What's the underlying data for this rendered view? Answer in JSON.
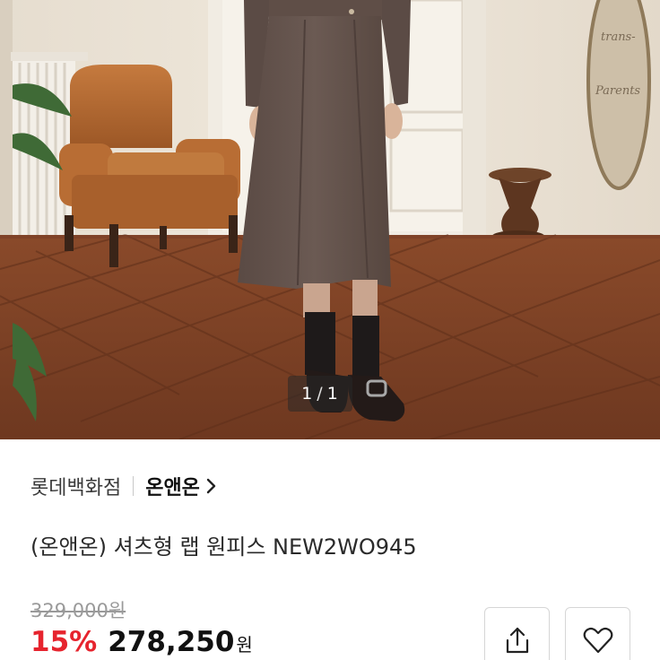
{
  "image_counter": {
    "current": "1",
    "separator": "/",
    "total": "1"
  },
  "product": {
    "store_name": "롯데백화점",
    "brand_name": "온앤온",
    "title": "(온앤온) 셔츠형 랩 원피스 NEW2WO945",
    "original_price": "329,000원",
    "discount": "15%",
    "sale_price": "278,250",
    "currency": "원"
  },
  "actions": {
    "share_icon": "share-icon",
    "wishlist_icon": "heart-icon"
  },
  "colors": {
    "discount": "#e6242e",
    "text": "#111111",
    "muted": "#9a9a9a"
  }
}
